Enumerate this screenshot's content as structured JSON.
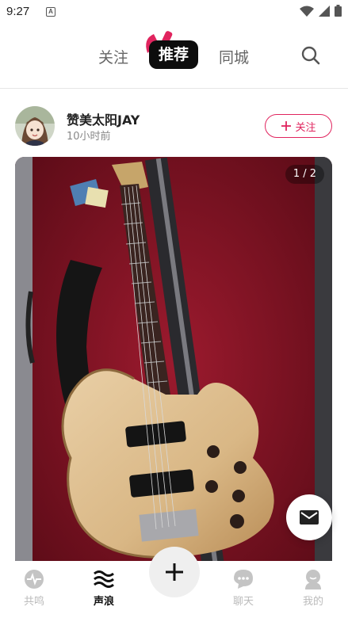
{
  "status_bar": {
    "time": "9:27",
    "notice_icon_letter": "A"
  },
  "top_nav": {
    "tabs": [
      {
        "label": "关注"
      },
      {
        "label": "推荐"
      },
      {
        "label": "同城"
      }
    ],
    "active_index": 1,
    "accent_color": "#e0245e"
  },
  "post": {
    "username": "赞美太阳JAY",
    "time": "10小时前",
    "follow_label": "关注",
    "image_counter": "1 / 2"
  },
  "bottom_nav": {
    "items": [
      {
        "label": "共鸣",
        "icon": "resonance-icon"
      },
      {
        "label": "声浪",
        "icon": "wave-icon"
      },
      {
        "label": "聊天",
        "icon": "chat-icon"
      },
      {
        "label": "我的",
        "icon": "profile-icon"
      }
    ],
    "active_index": 1
  }
}
